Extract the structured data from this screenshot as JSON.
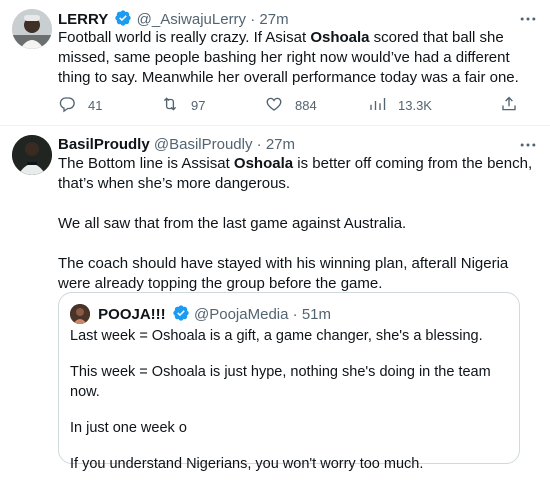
{
  "tweets": [
    {
      "name": "LERRY",
      "handle": "@_AsiwajuLerry",
      "dot": "·",
      "time": "27m",
      "body_before": "Football world is really crazy. If Asisat ",
      "body_bold": "Oshoala",
      "body_after": " scored that ball she missed, same people bashing her right now would’ve had a different thing to say. Meanwhile her overall performance today was a fair one.",
      "replies": "41",
      "retweets": "97",
      "likes": "884",
      "views": "13.3K"
    },
    {
      "name": "BasilProudly",
      "handle": "@BasilProudly",
      "dot": "·",
      "time": "27m",
      "p1_before": "The Bottom line is Assisat ",
      "p1_bold": "Oshoala",
      "p1_after": " is better off coming from the bench, that’s when she’s more dangerous.",
      "p2": "We all saw that from the last game against Australia.",
      "p3": "The coach should have stayed with his winning plan, afterall Nigeria were already topping the group before the game.",
      "quote": {
        "name": "POOJA!!!",
        "handle": "@PoojaMedia",
        "dot": "·",
        "time": "51m",
        "p1": "Last week = Oshoala is a gift, a game changer, she's a blessing.",
        "p2": "This week = Oshoala is just hype, nothing she's doing in the team now.",
        "p3": "In just one week o",
        "p4": "If you understand Nigerians, you won't worry too much."
      }
    }
  ],
  "colors": {
    "text": "#0f1419",
    "secondary": "#536471",
    "verified": "#1d9bf0",
    "border": "#cfd9de"
  },
  "icons": [
    "verified-icon",
    "more-icon",
    "reply-icon",
    "retweet-icon",
    "like-icon",
    "views-icon",
    "share-icon"
  ]
}
